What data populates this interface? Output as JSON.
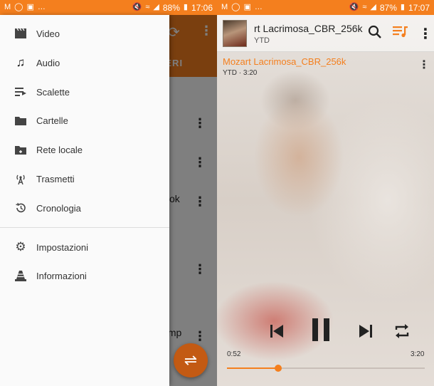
{
  "left_status": {
    "battery": "88%",
    "time": "17:06"
  },
  "right_status": {
    "battery": "87%",
    "time": "17:07"
  },
  "background_app": {
    "tab_label": "NERI",
    "snippets": [
      "ok",
      ".mp"
    ]
  },
  "drawer": {
    "items_top": [
      {
        "icon": "video-clapper-icon",
        "label": "Video"
      },
      {
        "icon": "music-note-icon",
        "label": "Audio"
      },
      {
        "icon": "playlist-icon",
        "label": "Scalette"
      },
      {
        "icon": "folder-icon",
        "label": "Cartelle"
      },
      {
        "icon": "network-folder-icon",
        "label": "Rete locale"
      },
      {
        "icon": "stream-antenna-icon",
        "label": "Trasmetti"
      },
      {
        "icon": "history-icon",
        "label": "Cronologia"
      }
    ],
    "items_bottom": [
      {
        "icon": "gear-icon",
        "label": "Impostazioni"
      },
      {
        "icon": "vlc-cone-icon",
        "label": "Informazioni"
      }
    ]
  },
  "player": {
    "header_title": "rt Lacrimosa_CBR_256k",
    "header_subtitle": "YTD",
    "song_title": "Mozart Lacrimosa_CBR_256k",
    "song_subtitle": "YTD  ·  3:20",
    "elapsed": "0:52",
    "duration": "3:20",
    "progress": 0.26,
    "accent_color": "#f47f1e"
  }
}
